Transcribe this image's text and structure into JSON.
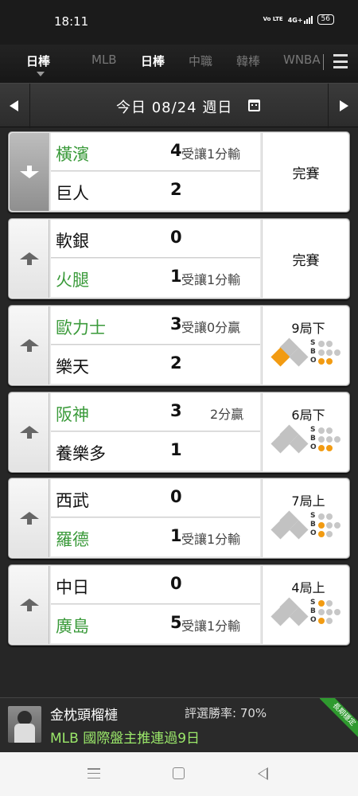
{
  "status_bar": {
    "time": "18:11",
    "volte": "Vo LTE",
    "network": "4G+",
    "battery": "56"
  },
  "tabs": [
    {
      "label": "日棒",
      "active": true
    },
    {
      "label": "MLB",
      "active": false
    },
    {
      "label": "日棒",
      "active": true
    },
    {
      "label": "中職",
      "active": false
    },
    {
      "label": "韓棒",
      "active": false
    },
    {
      "label": "WNBA",
      "active": false
    }
  ],
  "date_bar": {
    "label": "今日 08/24 週日"
  },
  "games": [
    {
      "away": "橫濱",
      "away_score": "4",
      "away_odds": "受讓1分輸",
      "home": "巨人",
      "home_score": "2",
      "home_odds": "",
      "status": "完賽",
      "expanded": true,
      "green": "away"
    },
    {
      "away": "軟銀",
      "away_score": "0",
      "away_odds": "",
      "home": "火腿",
      "home_score": "1",
      "home_odds": "受讓1分輸",
      "status": "完賽",
      "green": "home"
    },
    {
      "away": "歐力士",
      "away_score": "3",
      "away_odds": "受讓0分贏",
      "home": "樂天",
      "home_score": "2",
      "home_odds": "",
      "inning": "9局下",
      "bases": {
        "b1": false,
        "b2": false,
        "b3": true
      },
      "sbo": {
        "S": 0,
        "B": 0,
        "O": 2
      },
      "green": "away"
    },
    {
      "away": "阪神",
      "away_score": "3",
      "away_odds": "2分贏",
      "home": "養樂多",
      "home_score": "1",
      "home_odds": "",
      "inning": "6局下",
      "bases": {
        "b1": false,
        "b2": false,
        "b3": false
      },
      "sbo": {
        "S": 0,
        "B": 0,
        "O": 2
      },
      "green": "away"
    },
    {
      "away": "西武",
      "away_score": "0",
      "away_odds": "",
      "home": "羅德",
      "home_score": "1",
      "home_odds": "受讓1分輸",
      "inning": "7局上",
      "bases": {
        "b1": false,
        "b2": false,
        "b3": false
      },
      "sbo": {
        "S": 0,
        "B": 1,
        "O": 1
      },
      "green": "home"
    },
    {
      "away": "中日",
      "away_score": "0",
      "away_odds": "",
      "home": "廣島",
      "home_score": "5",
      "home_odds": "受讓1分輸",
      "inning": "4局上",
      "bases": {
        "b1": false,
        "b2": false,
        "b3": false
      },
      "sbo": {
        "S": 1,
        "B": 0,
        "O": 1
      },
      "green": "home"
    }
  ],
  "sbo_letters": {
    "s": "S",
    "b": "B",
    "o": "O"
  },
  "banner": {
    "name": "金枕頭榴槤",
    "rate": "評選勝率: 70%",
    "message": "MLB 國際盤主推連過9日",
    "ribbon": "長期穩定"
  },
  "colors": {
    "green_team": "#3a9a3a",
    "runner": "#f29b12",
    "banner_text": "#9be86a"
  }
}
